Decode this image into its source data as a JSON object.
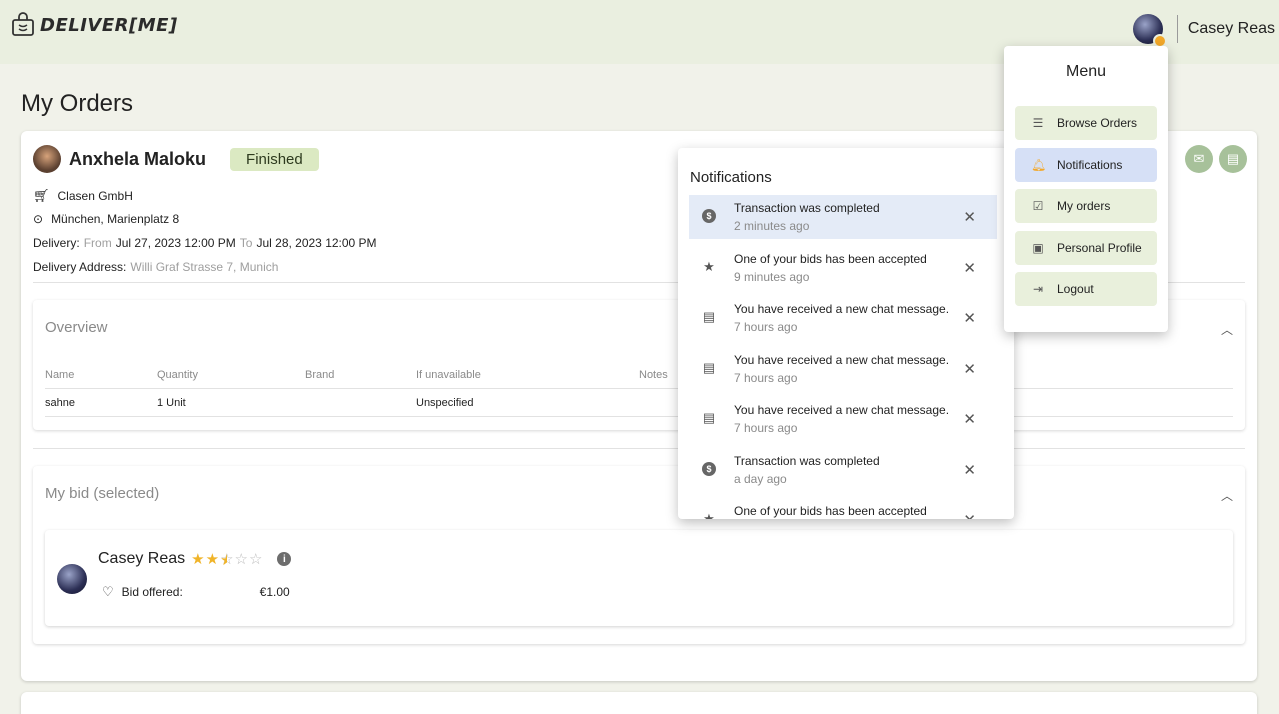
{
  "app": {
    "brand": "DELIVER[ME]"
  },
  "user": {
    "name": "Casey Reas"
  },
  "page": {
    "title": "My Orders"
  },
  "order": {
    "customer_name": "Anxhela Maloku",
    "status": "Finished",
    "shop": "Clasen GmbH",
    "location": "München, Marienplatz 8",
    "delivery_label": "Delivery:",
    "from_label": "From",
    "from_value": "Jul 27, 2023 12:00 PM",
    "to_label": "To",
    "to_value": "Jul 28, 2023 12:00 PM",
    "address_label": "Delivery Address:",
    "address_value": "Willi Graf Strasse 7, Munich"
  },
  "overview": {
    "title": "Overview",
    "columns": [
      "Name",
      "Quantity",
      "Brand",
      "If unavailable",
      "Notes"
    ],
    "rows": [
      {
        "name": "sahne",
        "quantity": "1 Unit",
        "brand": "",
        "if_unavailable": "Unspecified",
        "notes": ""
      }
    ]
  },
  "bid": {
    "title": "My bid (selected)",
    "bidder": "Casey Reas",
    "rating": 2.5,
    "rating_max": 5,
    "offered_label": "Bid offered:",
    "offered_value": "€1.00"
  },
  "notifications": {
    "title": "Notifications",
    "items": [
      {
        "icon": "coin-icon",
        "text": "Transaction was completed",
        "time": "2 minutes ago"
      },
      {
        "icon": "star-icon",
        "text": "One of your bids has been accepted",
        "time": "9 minutes ago"
      },
      {
        "icon": "chat-icon",
        "text": "You have received a new chat message.",
        "time": "7 hours ago"
      },
      {
        "icon": "chat-icon",
        "text": "You have received a new chat message.",
        "time": "7 hours ago"
      },
      {
        "icon": "chat-icon",
        "text": "You have received a new chat message.",
        "time": "7 hours ago"
      },
      {
        "icon": "coin-icon",
        "text": "Transaction was completed",
        "time": "a day ago"
      },
      {
        "icon": "star-icon",
        "text": "One of your bids has been accepted",
        "time": ""
      }
    ]
  },
  "menu": {
    "title": "Menu",
    "items": [
      {
        "icon": "list-icon",
        "label": "Browse Orders"
      },
      {
        "icon": "bell-icon",
        "label": "Notifications"
      },
      {
        "icon": "checklist-icon",
        "label": "My orders"
      },
      {
        "icon": "profile-icon",
        "label": "Personal Profile"
      },
      {
        "icon": "logout-icon",
        "label": "Logout"
      }
    ]
  },
  "colors": {
    "header_bg": "#eaefe0",
    "page_bg": "#f1f2ea",
    "status_badge": "#dbe9c2",
    "menu_item": "#e9f0dc",
    "active_item": "#d6e0f6",
    "star": "#f0b429",
    "bell": "#f3a829"
  }
}
